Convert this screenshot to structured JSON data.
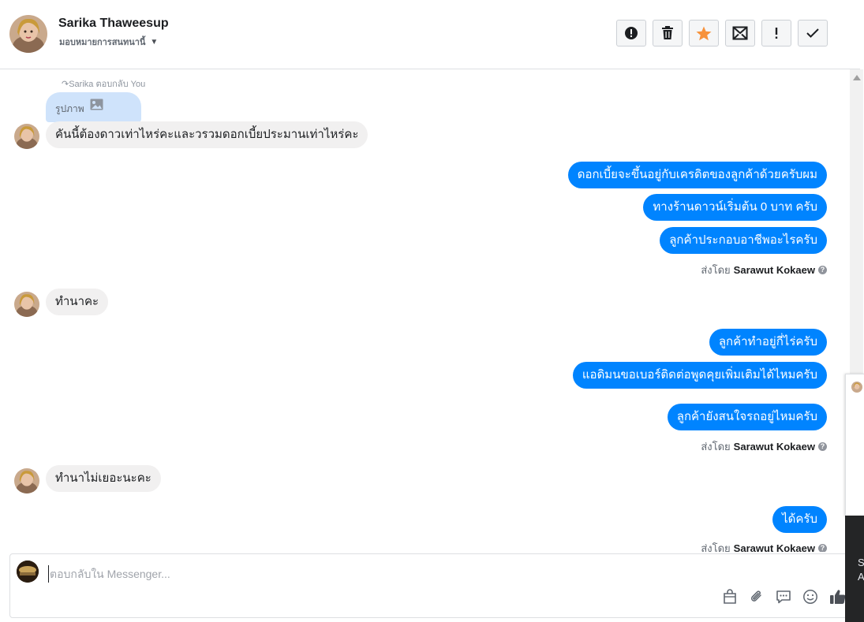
{
  "header": {
    "contact_name": "Sarika Thaweesup",
    "assign_label": "มอบหมายการสนทนานี้",
    "actions": [
      {
        "icon": "alert-circle-icon",
        "label": "Spam"
      },
      {
        "icon": "trash-icon",
        "label": "Delete"
      },
      {
        "icon": "star-icon",
        "label": "Star"
      },
      {
        "icon": "mark-unread-icon",
        "label": "Mark as unread"
      },
      {
        "icon": "exclamation-icon",
        "label": "Follow up"
      },
      {
        "icon": "check-icon",
        "label": "Done"
      }
    ]
  },
  "thread": {
    "reply_hint": "Sarika ตอบกลับ You",
    "photo_label": "รูปภาพ",
    "messages": [
      {
        "from": "in",
        "text": "คันนี้ต้องดาวเท่าไหร่คะและวรวมดอกเบี้ยประมานเท่าไหร่คะ"
      },
      {
        "from": "out",
        "text": "ดอกเบี้ยจะขึ้นอยู่กับเครดิตของลูกค้าด้วยครับผม"
      },
      {
        "from": "out",
        "text": "ทางร้านดาวน์เริ่มต้น 0 บาท ครับ"
      },
      {
        "from": "out",
        "text": "ลูกค้าประกอบอาชีพอะไรครับ"
      },
      {
        "from": "in",
        "text": "ทำนาคะ"
      },
      {
        "from": "out",
        "text": "ลูกค้าทำอยู่กี่ไร่ครับ"
      },
      {
        "from": "out",
        "text": "แอดิมนขอเบอร์ติดต่อพูดคุยเพิ่มเติมได้ไหมครับ"
      },
      {
        "from": "out",
        "text": "ลูกค้ายังสนใจรถอยู่ไหมครับ"
      },
      {
        "from": "in",
        "text": "ทำนาไม่เยอะนะคะ"
      },
      {
        "from": "out",
        "text": "ได้ครับ"
      }
    ],
    "sent_by_prefix": "ส่งโดย",
    "sent_by_name": "Sarawut Kokaew"
  },
  "composer": {
    "placeholder": "ตอบกลับใน Messenger...",
    "tools": [
      "shopping-bag-icon",
      "paperclip-icon",
      "saved-reply-icon",
      "emoji-icon",
      "thumbs-up-icon"
    ]
  },
  "side_widget": {
    "text_line_1": "S",
    "text_line_2": "A"
  },
  "colors": {
    "outgoing_bubble": "#0084ff",
    "incoming_bubble": "#f1f0f0",
    "star_accent": "#f7923b"
  }
}
